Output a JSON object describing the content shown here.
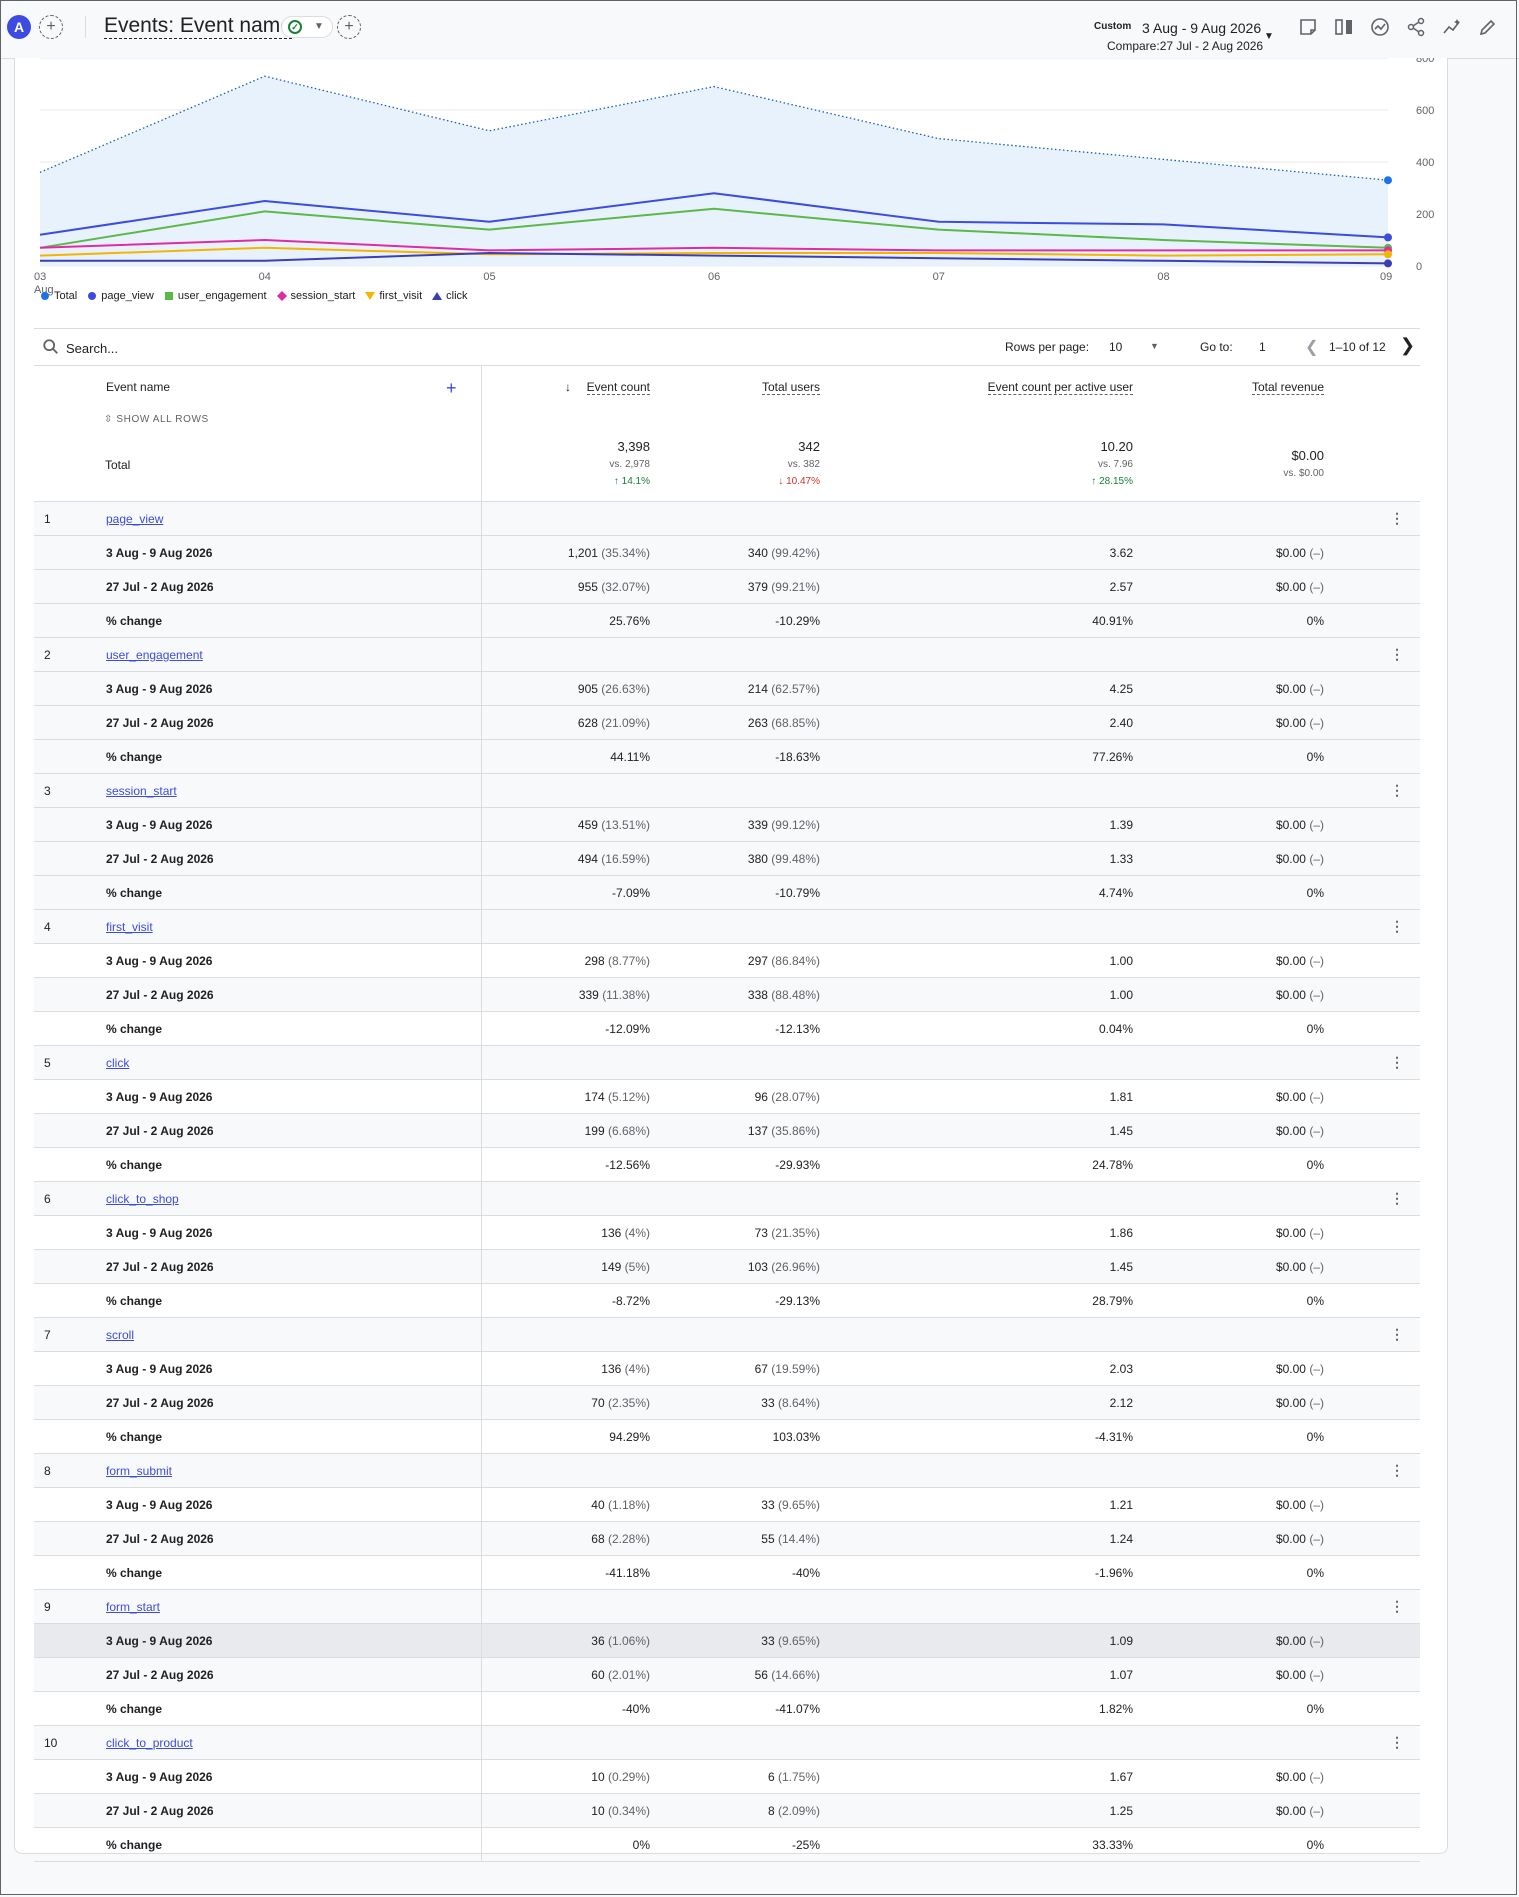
{
  "header": {
    "avatar_letter": "A",
    "title": "Events: Event name",
    "date_label": "Custom",
    "date_range": "3 Aug - 9 Aug 2026",
    "compare": "Compare:27 Jul - 2 Aug 2026"
  },
  "chart_data": {
    "type": "line",
    "x": [
      "03 Aug",
      "04",
      "05",
      "06",
      "07",
      "08",
      "09"
    ],
    "x_tick_labels": [
      "03",
      "04",
      "05",
      "06",
      "07",
      "08",
      "09"
    ],
    "x_sub_label": "Aug",
    "y_ticks": [
      "800",
      "600",
      "400",
      "200",
      "0"
    ],
    "ylim": [
      0,
      800
    ],
    "series": [
      {
        "name": "Total",
        "values": [
          360,
          730,
          520,
          690,
          490,
          410,
          330
        ],
        "color": "#1a73e8",
        "style": "dotted-area"
      },
      {
        "name": "page_view",
        "values": [
          120,
          250,
          170,
          280,
          170,
          160,
          110
        ],
        "color": "#3c4be0"
      },
      {
        "name": "user_engagement",
        "values": [
          70,
          210,
          140,
          220,
          140,
          100,
          70
        ],
        "color": "#5cb847"
      },
      {
        "name": "session_start",
        "values": [
          70,
          100,
          60,
          70,
          60,
          60,
          60
        ],
        "color": "#e02ca3"
      },
      {
        "name": "first_visit",
        "values": [
          40,
          70,
          45,
          50,
          50,
          40,
          45
        ],
        "color": "#f4b400"
      },
      {
        "name": "click",
        "values": [
          20,
          20,
          50,
          40,
          30,
          20,
          10
        ],
        "color": "#3b3fb3"
      }
    ],
    "grid": true,
    "legend_position": "bottom-left"
  },
  "legend": [
    {
      "name": "Total",
      "color": "#1a73e8",
      "shape": "pin"
    },
    {
      "name": "page_view",
      "color": "#3c4be0",
      "shape": "circle"
    },
    {
      "name": "user_engagement",
      "color": "#5cb847",
      "shape": "square"
    },
    {
      "name": "session_start",
      "color": "#e02ca3",
      "shape": "diamond"
    },
    {
      "name": "first_visit",
      "color": "#f4b400",
      "shape": "triangle-down"
    },
    {
      "name": "click",
      "color": "#3b3fb3",
      "shape": "triangle-up"
    }
  ],
  "search": {
    "placeholder": "Search..."
  },
  "pagination": {
    "rows_label": "Rows per page:",
    "rows_value": "10",
    "goto_label": "Go to:",
    "goto_value": "1",
    "range": "1–10 of 12"
  },
  "table": {
    "headers": {
      "event_name": "Event name",
      "event_count": "Event count",
      "total_users": "Total users",
      "per_user": "Event count per active user",
      "revenue": "Total revenue"
    },
    "show_all": "SHOW ALL ROWS",
    "total_label": "Total",
    "totals": {
      "event_count": {
        "main": "3,398",
        "vs": "vs. 2,978",
        "change": "↑ 14.1%"
      },
      "total_users": {
        "main": "342",
        "vs": "vs. 382",
        "change": "↓ 10.47%"
      },
      "per_user": {
        "main": "10.20",
        "vs": "vs. 7.96",
        "change": "↑ 28.15%"
      },
      "revenue": {
        "main": "$0.00",
        "vs": "vs. $0.00"
      }
    },
    "row_labels": {
      "cur": "3 Aug - 9 Aug 2026",
      "prev": "27 Jul - 2 Aug 2026",
      "chg": "% change"
    },
    "events": [
      {
        "num": "1",
        "name": "page_view",
        "cur": [
          "1,201",
          "(35.34%)",
          "340",
          "(99.42%)",
          "3.62",
          "$0.00",
          "(–)"
        ],
        "prev": [
          "955",
          "(32.07%)",
          "379",
          "(99.21%)",
          "2.57",
          "$0.00",
          "(–)"
        ],
        "chg": [
          "25.76%",
          "-10.29%",
          "40.91%",
          "0%"
        ]
      },
      {
        "num": "2",
        "name": "user_engagement",
        "cur": [
          "905",
          "(26.63%)",
          "214",
          "(62.57%)",
          "4.25",
          "$0.00",
          "(–)"
        ],
        "prev": [
          "628",
          "(21.09%)",
          "263",
          "(68.85%)",
          "2.40",
          "$0.00",
          "(–)"
        ],
        "chg": [
          "44.11%",
          "-18.63%",
          "77.26%",
          "0%"
        ]
      },
      {
        "num": "3",
        "name": "session_start",
        "cur": [
          "459",
          "(13.51%)",
          "339",
          "(99.12%)",
          "1.39",
          "$0.00",
          "(–)"
        ],
        "prev": [
          "494",
          "(16.59%)",
          "380",
          "(99.48%)",
          "1.33",
          "$0.00",
          "(–)"
        ],
        "chg": [
          "-7.09%",
          "-10.79%",
          "4.74%",
          "0%"
        ]
      },
      {
        "num": "4",
        "name": "first_visit",
        "cur": [
          "298",
          "(8.77%)",
          "297",
          "(86.84%)",
          "1.00",
          "$0.00",
          "(–)"
        ],
        "prev": [
          "339",
          "(11.38%)",
          "338",
          "(88.48%)",
          "1.00",
          "$0.00",
          "(–)"
        ],
        "chg": [
          "-12.09%",
          "-12.13%",
          "0.04%",
          "0%"
        ]
      },
      {
        "num": "5",
        "name": "click",
        "cur": [
          "174",
          "(5.12%)",
          "96",
          "(28.07%)",
          "1.81",
          "$0.00",
          "(–)"
        ],
        "prev": [
          "199",
          "(6.68%)",
          "137",
          "(35.86%)",
          "1.45",
          "$0.00",
          "(–)"
        ],
        "chg": [
          "-12.56%",
          "-29.93%",
          "24.78%",
          "0%"
        ]
      },
      {
        "num": "6",
        "name": "click_to_shop",
        "cur": [
          "136",
          "(4%)",
          "73",
          "(21.35%)",
          "1.86",
          "$0.00",
          "(–)"
        ],
        "prev": [
          "149",
          "(5%)",
          "103",
          "(26.96%)",
          "1.45",
          "$0.00",
          "(–)"
        ],
        "chg": [
          "-8.72%",
          "-29.13%",
          "28.79%",
          "0%"
        ]
      },
      {
        "num": "7",
        "name": "scroll",
        "cur": [
          "136",
          "(4%)",
          "67",
          "(19.59%)",
          "2.03",
          "$0.00",
          "(–)"
        ],
        "prev": [
          "70",
          "(2.35%)",
          "33",
          "(8.64%)",
          "2.12",
          "$0.00",
          "(–)"
        ],
        "chg": [
          "94.29%",
          "103.03%",
          "-4.31%",
          "0%"
        ]
      },
      {
        "num": "8",
        "name": "form_submit",
        "cur": [
          "40",
          "(1.18%)",
          "33",
          "(9.65%)",
          "1.21",
          "$0.00",
          "(–)"
        ],
        "prev": [
          "68",
          "(2.28%)",
          "55",
          "(14.4%)",
          "1.24",
          "$0.00",
          "(–)"
        ],
        "chg": [
          "-41.18%",
          "-40%",
          "-1.96%",
          "0%"
        ]
      },
      {
        "num": "9",
        "name": "form_start",
        "cur": [
          "36",
          "(1.06%)",
          "33",
          "(9.65%)",
          "1.09",
          "$0.00",
          "(–)"
        ],
        "prev": [
          "60",
          "(2.01%)",
          "56",
          "(14.66%)",
          "1.07",
          "$0.00",
          "(–)"
        ],
        "chg": [
          "-40%",
          "-41.07%",
          "1.82%",
          "0%"
        ]
      },
      {
        "num": "10",
        "name": "click_to_product",
        "cur": [
          "10",
          "(0.29%)",
          "6",
          "(1.75%)",
          "1.67",
          "$0.00",
          "(–)"
        ],
        "prev": [
          "10",
          "(0.34%)",
          "8",
          "(2.09%)",
          "1.25",
          "$0.00",
          "(–)"
        ],
        "chg": [
          "0%",
          "-25%",
          "33.33%",
          "0%"
        ]
      }
    ]
  }
}
